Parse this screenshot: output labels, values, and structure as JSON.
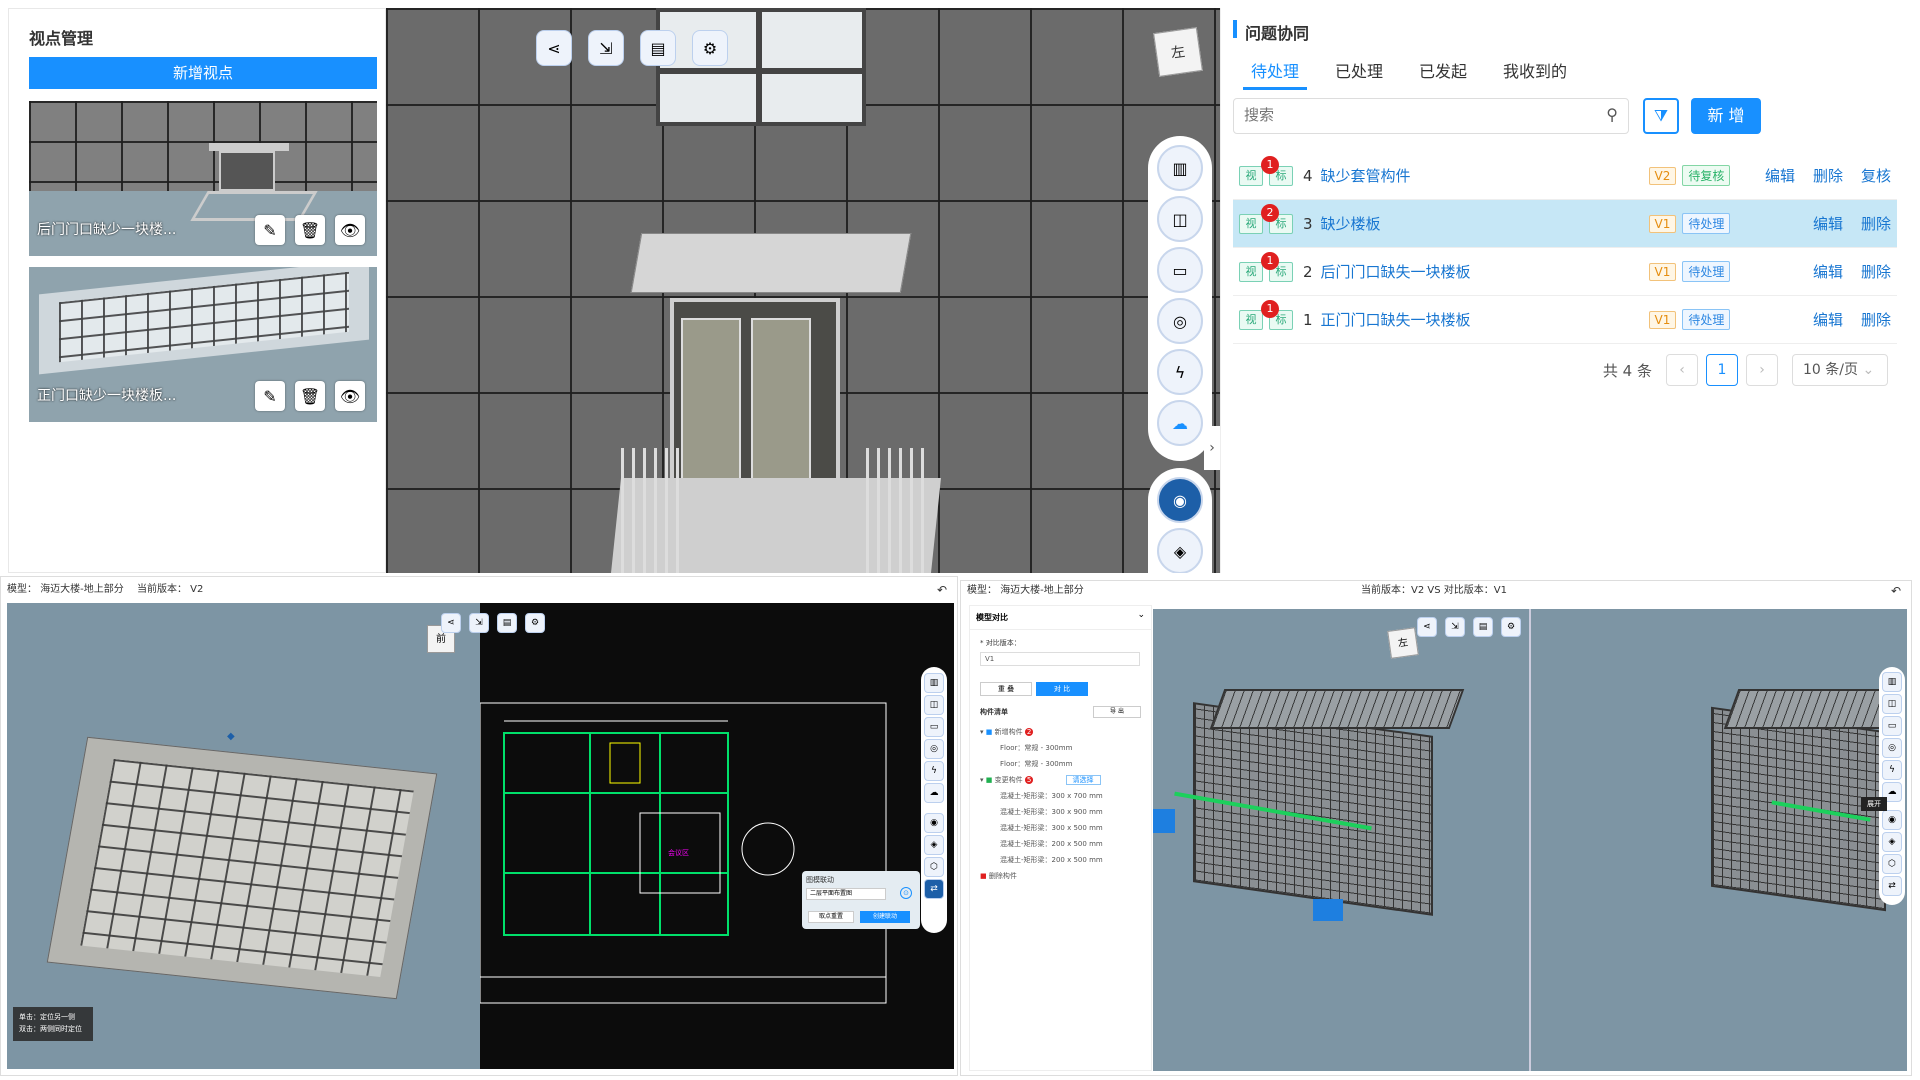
{
  "viewpoints": {
    "title": "视点管理",
    "add_button": "新增视点",
    "items": [
      {
        "label": "后门门口缺少一块楼..."
      },
      {
        "label": "正门口缺少一块楼板..."
      }
    ]
  },
  "viewcube_top": "左",
  "issues": {
    "title": "问题协同",
    "tabs": [
      "待处理",
      "已处理",
      "已发起",
      "我收到的"
    ],
    "active_tab": 0,
    "search_placeholder": "搜索",
    "new_button": "新 增",
    "chip_view": "视",
    "chip_mark": "标",
    "rows": [
      {
        "badge": "1",
        "num": "4",
        "title": "缺少套管构件",
        "version": "V2",
        "status": "待复核",
        "actions": [
          "编辑",
          "删除",
          "复核"
        ],
        "highlight": false
      },
      {
        "badge": "2",
        "num": "3",
        "title": "缺少楼板",
        "version": "V1",
        "status": "待处理",
        "actions": [
          "编辑",
          "删除"
        ],
        "highlight": true
      },
      {
        "badge": "1",
        "num": "2",
        "title": "后门门口缺失一块楼板",
        "version": "V1",
        "status": "待处理",
        "actions": [
          "编辑",
          "删除"
        ],
        "highlight": false
      },
      {
        "badge": "1",
        "num": "1",
        "title": "正门门口缺失一块楼板",
        "version": "V1",
        "status": "待处理",
        "actions": [
          "编辑",
          "删除"
        ],
        "highlight": false
      }
    ],
    "pagination": {
      "total": "共 4 条",
      "page": "1",
      "page_size": "10 条/页"
    }
  },
  "bottom_left": {
    "model_label": "模型：",
    "model_name": "海迈大楼-地上部分",
    "version_label": "当前版本：",
    "version": "V2",
    "viewcube": "前",
    "linkage_title": "图模联动",
    "drawing_select": "二层平面布置图",
    "btn_reset": "取点重置",
    "btn_create": "创建联动",
    "hint_line1": "单击：定位另一侧",
    "hint_line2": "双击：两侧同时定位",
    "cad_room": "会议区"
  },
  "bottom_right": {
    "model_label": "模型：",
    "model_name": "海迈大楼-地上部分",
    "compare_text": "当前版本：V2  VS  对比版本：V1",
    "panel_title": "模型对比",
    "compare_version_label": "* 对比版本：",
    "compare_version_value": "V1",
    "btn_overlap": "重 叠",
    "btn_compare": "对 比",
    "list_title": "构件清单",
    "export": "导 出",
    "added_group": "新增构件",
    "added_count": "2",
    "added_items": [
      "Floor：常规 - 300mm",
      "Floor：常规 - 300mm"
    ],
    "changed_group": "变更构件",
    "changed_count": "5",
    "changed_select": "请选择",
    "changed_items": [
      "混凝土-矩形梁：300 x 700 mm",
      "混凝土-矩形梁：300 x 900 mm",
      "混凝土-矩形梁：300 x 500 mm",
      "混凝土-矩形梁：200 x 500 mm",
      "混凝土-矩形梁：200 x 500 mm"
    ],
    "deleted_group": "删除构件",
    "viewcube": "左",
    "expand": "展开"
  },
  "colors": {
    "primary": "#1890ff",
    "cad_green": "#00e06a",
    "cad_bg": "#0c0c0c",
    "scene_bg": "#7d95a4"
  }
}
